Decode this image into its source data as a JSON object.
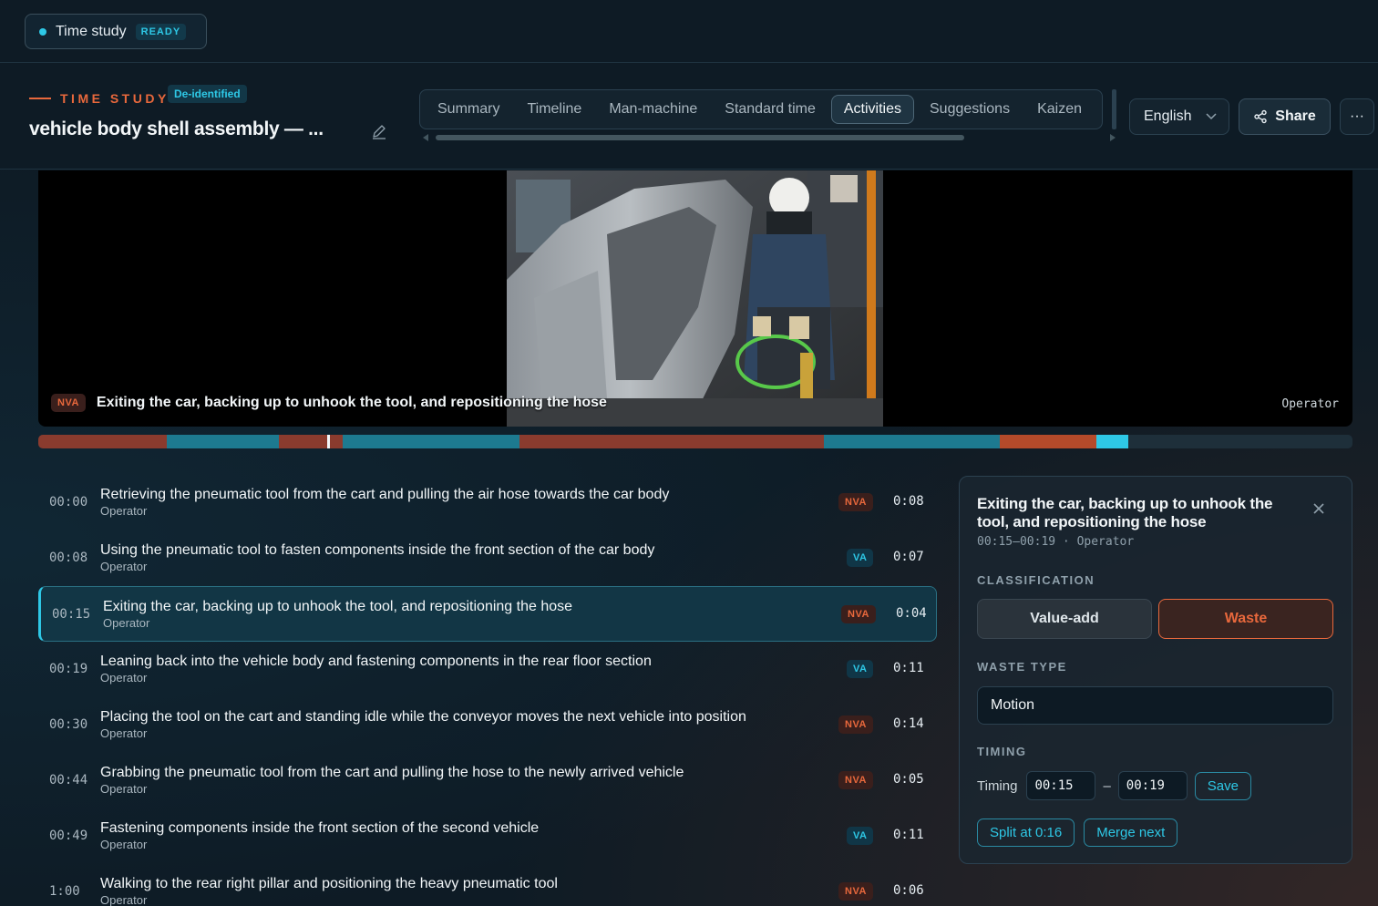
{
  "status_pill": {
    "label": "Time study",
    "badge": "READY"
  },
  "header": {
    "eyebrow": "TIME STUDY",
    "deidentified_badge": "De-identified",
    "title": "vehicle body shell assembly — ...",
    "tabs": [
      {
        "label": "Summary",
        "active": false
      },
      {
        "label": "Timeline",
        "active": false
      },
      {
        "label": "Man-machine",
        "active": false
      },
      {
        "label": "Standard time",
        "active": false
      },
      {
        "label": "Activities",
        "active": true
      },
      {
        "label": "Suggestions",
        "active": false
      },
      {
        "label": "Kaizen",
        "active": false
      }
    ],
    "language": "English",
    "share_label": "Share",
    "more_label": "···"
  },
  "video": {
    "caption_badge": "NVA",
    "caption_text": "Exiting the car, backing up to unhook the tool, and repositioning the hose",
    "operator_label": "Operator"
  },
  "timeline": {
    "duration_s": 82,
    "playhead_s": 18,
    "segments": [
      {
        "start": 0,
        "end": 8,
        "type": "NVA"
      },
      {
        "start": 8,
        "end": 15,
        "type": "VA"
      },
      {
        "start": 15,
        "end": 19,
        "type": "NVA"
      },
      {
        "start": 19,
        "end": 30,
        "type": "VA"
      },
      {
        "start": 30,
        "end": 49,
        "type": "NVA"
      },
      {
        "start": 49,
        "end": 60,
        "type": "VA"
      },
      {
        "start": 60,
        "end": 66,
        "type": "NVA-selected"
      },
      {
        "start": 66,
        "end": 68,
        "type": "VA-bright"
      }
    ]
  },
  "activities": [
    {
      "time": "00:00",
      "text": "Retrieving the pneumatic tool from the cart and pulling the air hose towards the car body",
      "operator": "Operator",
      "type": "NVA",
      "duration": "0:08",
      "selected": false
    },
    {
      "time": "00:08",
      "text": "Using the pneumatic tool to fasten components inside the front section of the car body",
      "operator": "Operator",
      "type": "VA",
      "duration": "0:07",
      "selected": false
    },
    {
      "time": "00:15",
      "text": "Exiting the car, backing up to unhook the tool, and repositioning the hose",
      "operator": "Operator",
      "type": "NVA",
      "duration": "0:04",
      "selected": true
    },
    {
      "time": "00:19",
      "text": "Leaning back into the vehicle body and fastening components in the rear floor section",
      "operator": "Operator",
      "type": "VA",
      "duration": "0:11",
      "selected": false
    },
    {
      "time": "00:30",
      "text": "Placing the tool on the cart and standing idle while the conveyor moves the next vehicle into position",
      "operator": "Operator",
      "type": "NVA",
      "duration": "0:14",
      "selected": false
    },
    {
      "time": "00:44",
      "text": "Grabbing the pneumatic tool from the cart and pulling the hose to the newly arrived vehicle",
      "operator": "Operator",
      "type": "NVA",
      "duration": "0:05",
      "selected": false
    },
    {
      "time": "00:49",
      "text": "Fastening components inside the front section of the second vehicle",
      "operator": "Operator",
      "type": "VA",
      "duration": "0:11",
      "selected": false
    },
    {
      "time": "1:00",
      "text": "Walking to the rear right pillar and positioning the heavy pneumatic tool",
      "operator": "Operator",
      "type": "NVA",
      "duration": "0:06",
      "selected": false
    }
  ],
  "panel": {
    "title": "Exiting the car, backing up to unhook the tool, and repositioning the hose",
    "meta": "00:15–00:19 · Operator",
    "classification_heading": "CLASSIFICATION",
    "value_add_label": "Value-add",
    "waste_label": "Waste",
    "waste_type_heading": "WASTE TYPE",
    "waste_type_value": "Motion",
    "timing_heading": "TIMING",
    "timing_label": "Timing",
    "start_value": "00:15",
    "end_value": "00:19",
    "separator": "–",
    "save_label": "Save",
    "split_label": "Split at 0:16",
    "merge_label": "Merge next"
  },
  "colors": {
    "accent_cyan": "#2ec8e6",
    "accent_orange": "#e8683c",
    "nva_segment": "#8a3b2e",
    "va_segment": "#1d7a90"
  }
}
